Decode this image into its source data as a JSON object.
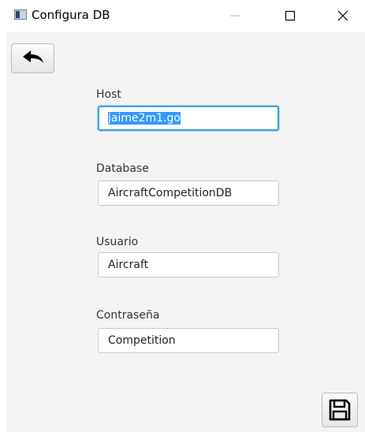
{
  "window": {
    "title": "Configura DB",
    "icons": {
      "app": "app-window-icon",
      "minimize": "minimize-icon",
      "maximize": "maximize-icon",
      "close": "close-icon"
    }
  },
  "toolbar": {
    "back_icon": "back-arrow-icon"
  },
  "form": {
    "host": {
      "label": "Host",
      "value": "jaime2m1.go"
    },
    "database": {
      "label": "Database",
      "value": "AircraftCompetitionDB"
    },
    "usuario": {
      "label": "Usuario",
      "value": "Aircraft"
    },
    "contrasena": {
      "label": "Contraseña",
      "value": "Competition"
    }
  },
  "actions": {
    "save_icon": "save-floppy-icon"
  },
  "colors": {
    "focus_border": "#3fa0e0",
    "selection": "#3399ff",
    "panel_bg": "#f4f4f4"
  }
}
